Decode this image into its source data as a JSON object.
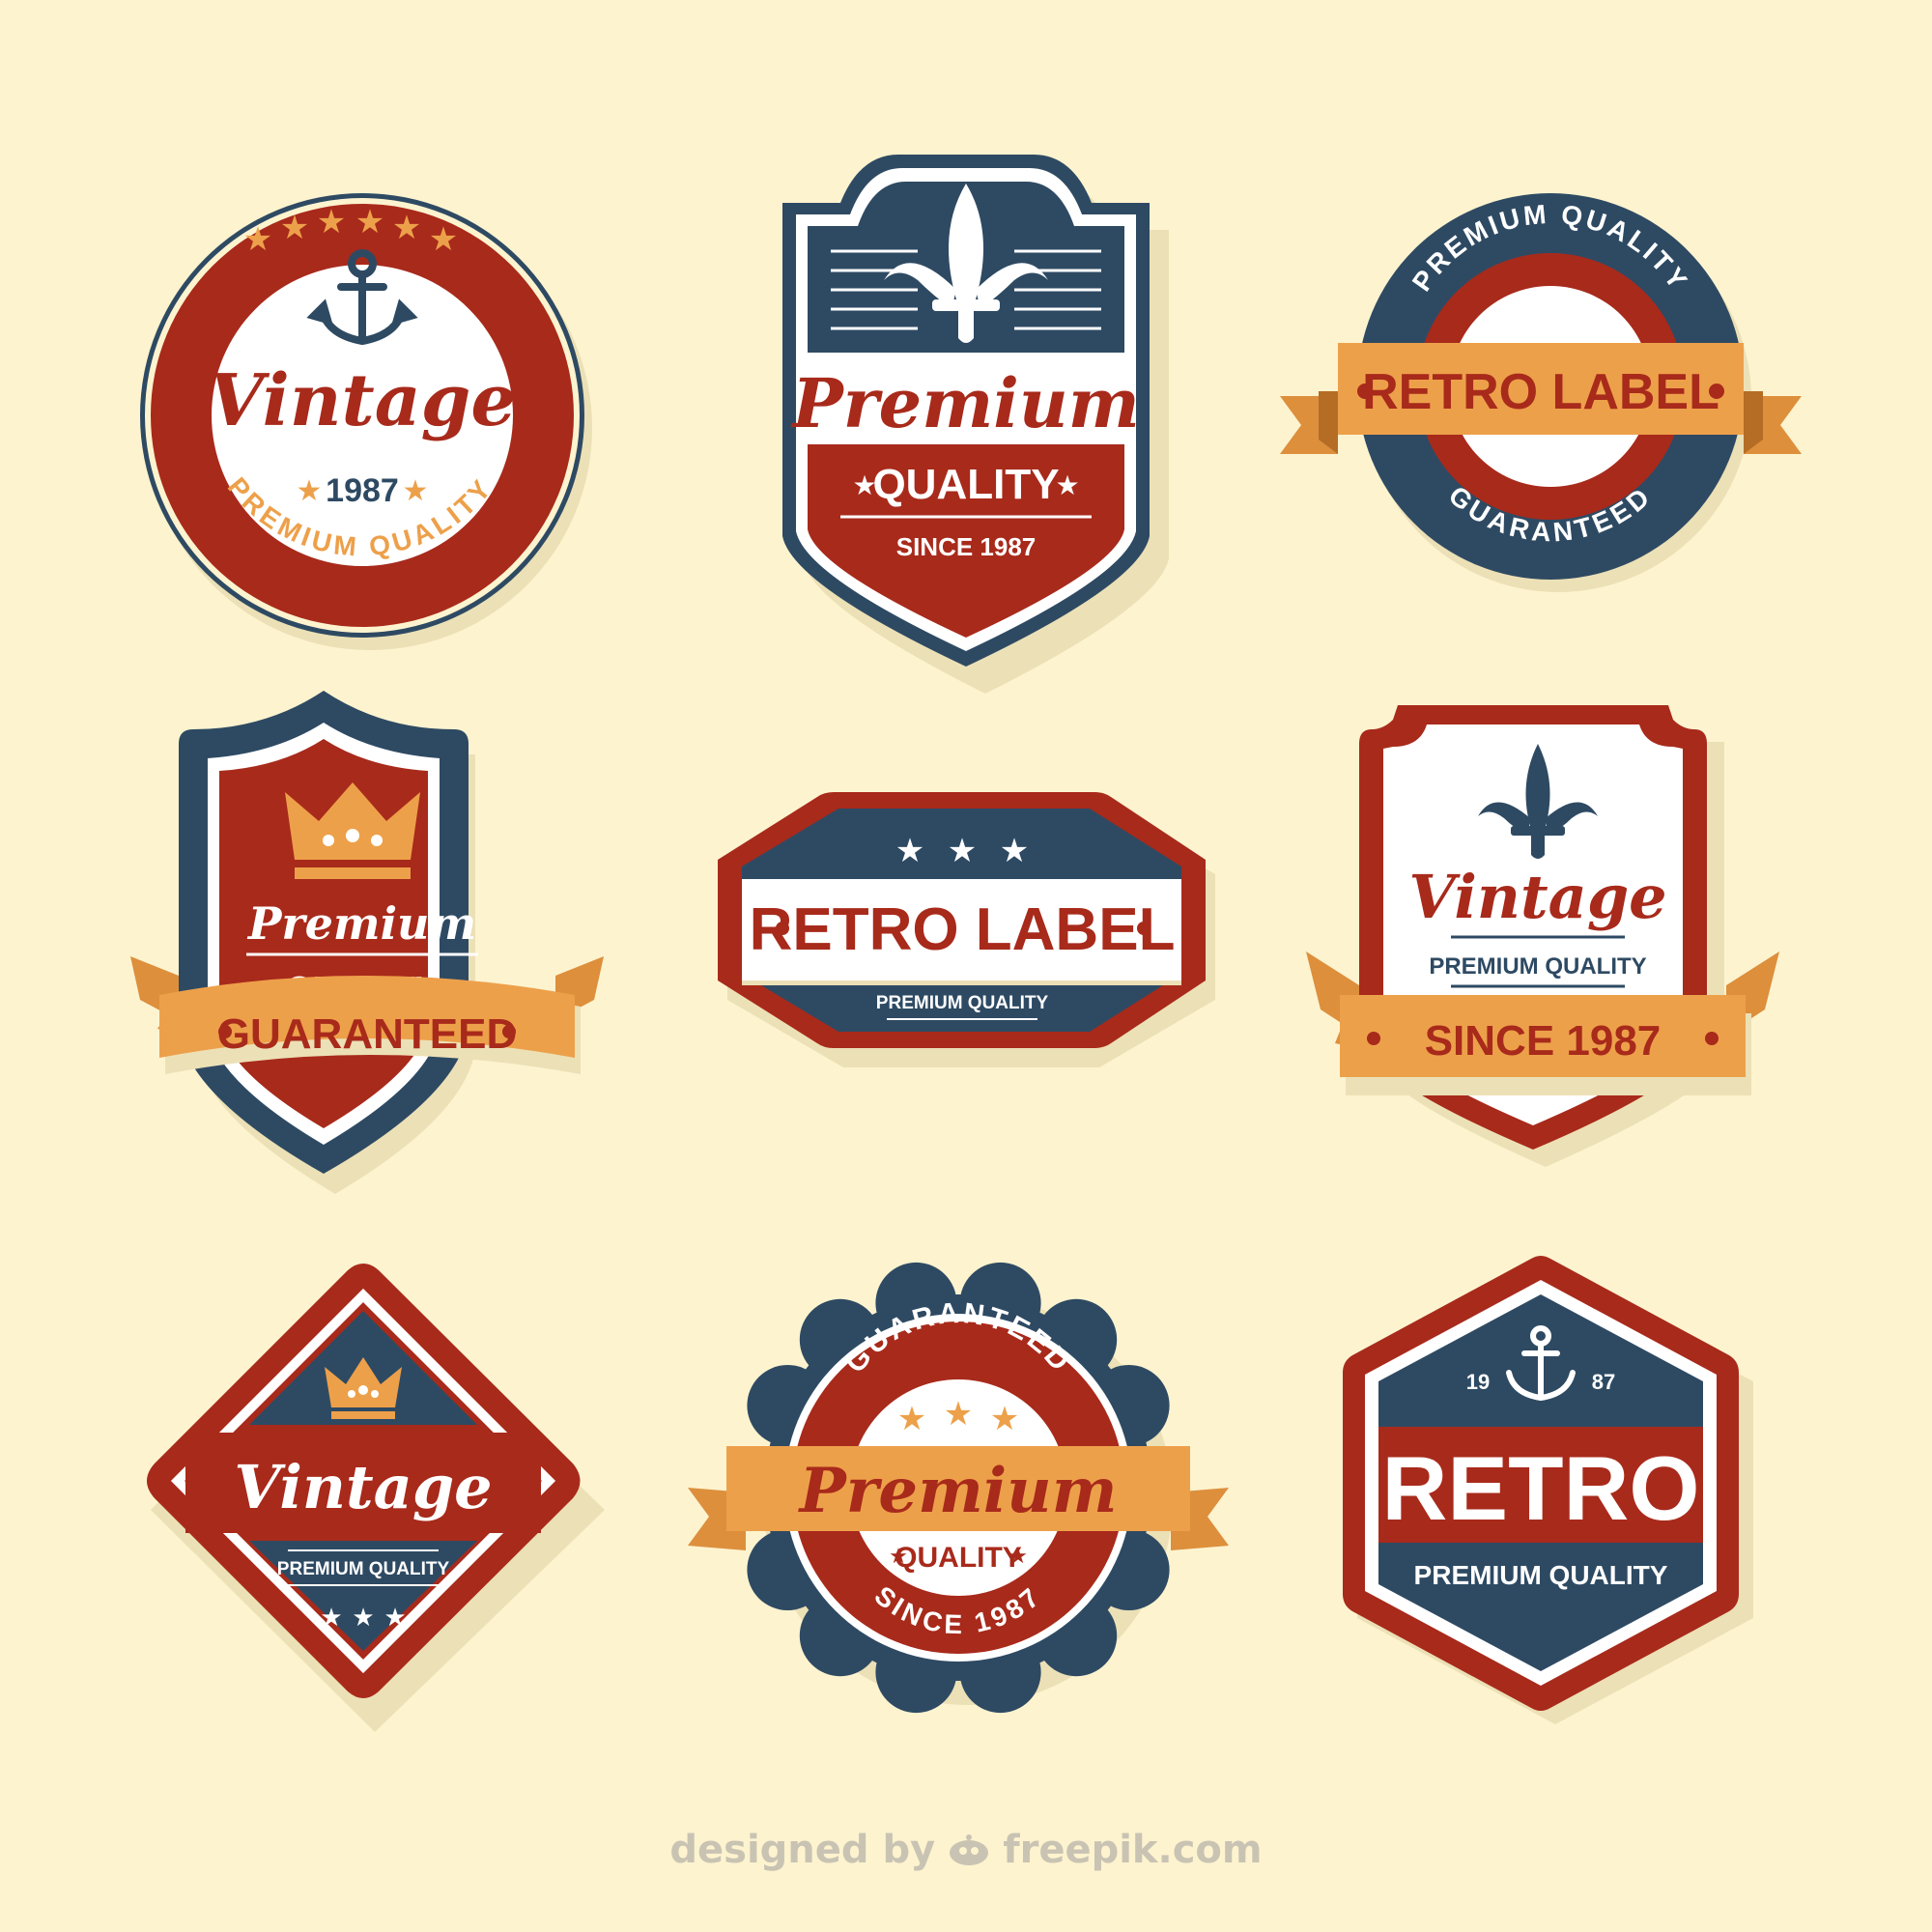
{
  "colors": {
    "background": "#fdf3cf",
    "red": "#a82a1b",
    "navy": "#2e4a63",
    "orange": "#eda04a",
    "white": "#ffffff",
    "shadow": "#ece0b6"
  },
  "badges": {
    "b1": {
      "icon": "anchor-icon",
      "title": "Vintage",
      "year": "1987",
      "arc": "PREMIUM QUALITY"
    },
    "b2": {
      "icon": "fleur-de-lis-icon",
      "title": "Premium",
      "subtitle": "QUALITY",
      "since": "SINCE 1987"
    },
    "b3": {
      "arc_top": "PREMIUM QUALITY",
      "ribbon": "RETRO LABEL",
      "arc_bottom": "GUARANTEED"
    },
    "b4": {
      "icon": "crown-icon",
      "title": "Premium",
      "subtitle": "QUALITY",
      "ribbon": "GUARANTEED"
    },
    "b5": {
      "title": "RETRO LABEL",
      "subtitle": "PREMIUM QUALITY"
    },
    "b6": {
      "icon": "fleur-de-lis-icon",
      "title": "Vintage",
      "subtitle": "PREMIUM QUALITY",
      "ribbon": "SINCE 1987"
    },
    "b7": {
      "icon": "crown-icon",
      "title": "Vintage",
      "subtitle": "PREMIUM QUALITY"
    },
    "b8": {
      "arc_top": "GUARANTEED",
      "ribbon": "Premium",
      "subtitle": "QUALITY",
      "arc_bottom": "SINCE 1987"
    },
    "b9": {
      "icon": "anchor-icon",
      "year_left": "19",
      "year_right": "87",
      "title": "RETRO",
      "subtitle": "PREMIUM QUALITY"
    }
  },
  "credit": {
    "prefix": "designed by",
    "brand": "freepik.com"
  }
}
